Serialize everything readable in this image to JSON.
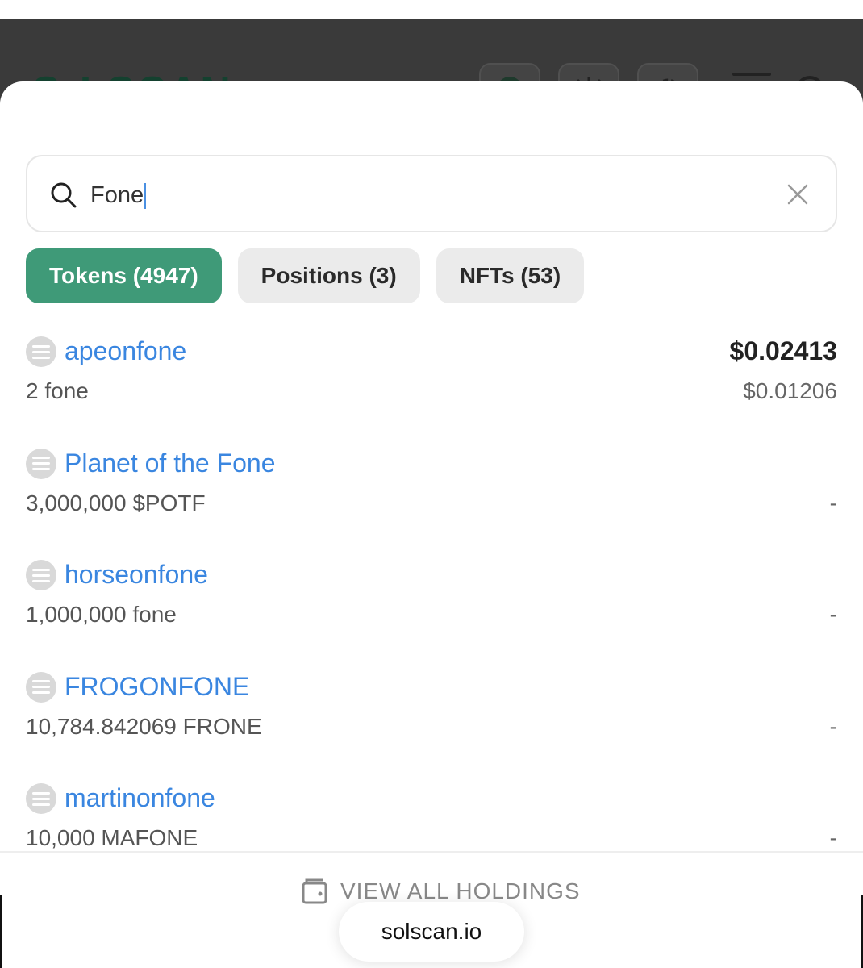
{
  "header": {
    "logo_text": "SOLSCAN",
    "buttons": [
      {
        "icon": "network-icon"
      },
      {
        "icon": "sun-icon"
      },
      {
        "icon": "gear-icon"
      },
      {
        "icon": "menu-icon"
      },
      {
        "icon": "search-icon"
      }
    ]
  },
  "search": {
    "value": "Fone",
    "icon": "search-icon",
    "clear_icon": "close-icon"
  },
  "tabs": [
    {
      "label": "Tokens (4947)",
      "active": true
    },
    {
      "label": "Positions (3)",
      "active": false
    },
    {
      "label": "NFTs (53)",
      "active": false
    }
  ],
  "tokens": [
    {
      "name": "apeonfone",
      "amount": "2 fone",
      "price": "$0.02413",
      "value": "$0.01206"
    },
    {
      "name": "Planet of the Fone",
      "amount": "3,000,000 $POTF",
      "price": "",
      "value": "-"
    },
    {
      "name": "horseonfone",
      "amount": "1,000,000 fone",
      "price": "",
      "value": "-"
    },
    {
      "name": "FROGONFONE",
      "amount": "10,784.842069 FRONE",
      "price": "",
      "value": "-"
    },
    {
      "name": "martinonfone",
      "amount": "10,000 MAFONE",
      "price": "",
      "value": "-"
    }
  ],
  "footer": {
    "view_all_label": "VIEW ALL HOLDINGS",
    "view_all_icon": "wallet-icon"
  },
  "browser": {
    "url": "solscan.io"
  },
  "colors": {
    "accent": "#3f9a78",
    "link": "#3a86e0",
    "backdrop": "#3a3a3a"
  }
}
